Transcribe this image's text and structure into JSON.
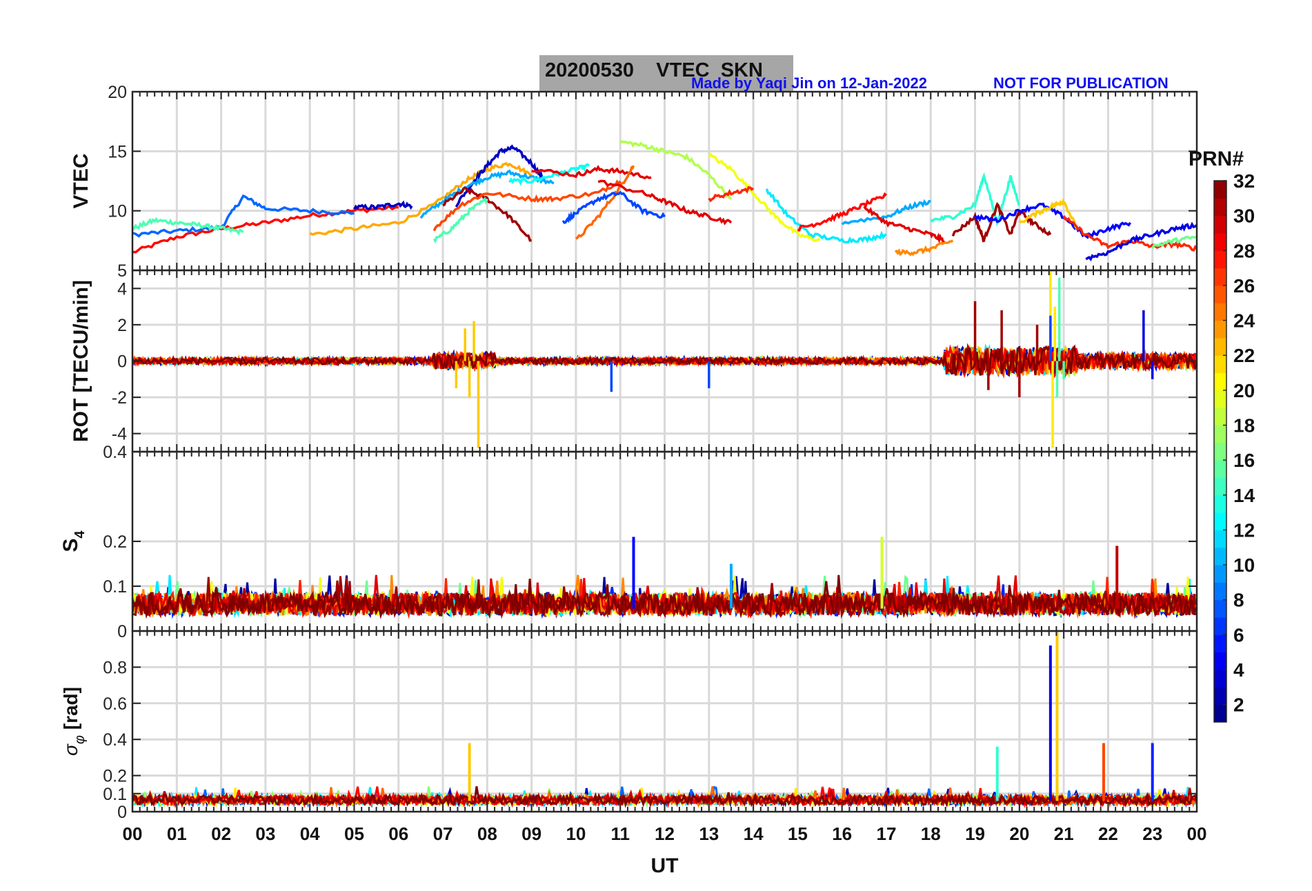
{
  "figure": {
    "title": "20200530    VTEC  SKN",
    "credit": "Made by Yaqi Jin on 12-Jan-2022",
    "notice": "NOT FOR PUBLICATION",
    "xlabel": "UT",
    "x_ticks": [
      "00",
      "01",
      "02",
      "03",
      "04",
      "05",
      "06",
      "07",
      "08",
      "09",
      "10",
      "11",
      "12",
      "13",
      "14",
      "15",
      "16",
      "17",
      "18",
      "19",
      "20",
      "21",
      "22",
      "23",
      "00"
    ]
  },
  "colorbar": {
    "label": "PRN#",
    "range": [
      1,
      32
    ],
    "ticks": [
      "2",
      "4",
      "6",
      "8",
      "10",
      "12",
      "14",
      "16",
      "18",
      "20",
      "22",
      "24",
      "26",
      "28",
      "30",
      "32"
    ],
    "colormap": "jet",
    "colors": [
      "#00008f",
      "#0000ff",
      "#007fff",
      "#00ffff",
      "#7fff7f",
      "#ffff00",
      "#ff7f00",
      "#ff0000",
      "#7f0000"
    ]
  },
  "chart_data": [
    {
      "type": "line",
      "ylabel": "VTEC",
      "ylim": [
        5,
        20
      ],
      "y_ticks": [
        "5",
        "10",
        "15",
        "20"
      ],
      "grid": true,
      "note": "Multiple PRN traces colored by PRN number via jet colormap",
      "series": [
        {
          "prn": 28,
          "x": [
            0.0,
            1.0,
            2.0,
            3.0,
            4.0,
            5.0,
            6.0
          ],
          "y": [
            6.5,
            7.8,
            8.5,
            9.0,
            9.6,
            10.0,
            10.3
          ]
        },
        {
          "prn": 8,
          "x": [
            0.0,
            1.0,
            2.0,
            2.5,
            3.0,
            4.0,
            5.0
          ],
          "y": [
            8.0,
            8.3,
            8.6,
            11.2,
            10.2,
            10.0,
            9.8
          ]
        },
        {
          "prn": 15,
          "x": [
            0.0,
            0.5,
            1.0,
            1.5,
            2.0,
            2.5
          ],
          "y": [
            8.5,
            9.2,
            9.0,
            8.8,
            8.5,
            8.2
          ]
        },
        {
          "prn": 3,
          "x": [
            5.0,
            5.5,
            6.0,
            6.3
          ],
          "y": [
            10.3,
            10.3,
            10.6,
            10.4
          ]
        },
        {
          "prn": 23,
          "x": [
            4.0,
            5.0,
            6.0,
            6.8,
            7.5,
            8.0,
            8.5,
            9.0
          ],
          "y": [
            8.0,
            8.5,
            9.0,
            10.5,
            12.5,
            13.5,
            14.0,
            13.0
          ]
        },
        {
          "prn": 3,
          "x": [
            7.3,
            7.7,
            8.0,
            8.3,
            8.6,
            9.0,
            9.3
          ],
          "y": [
            10.5,
            12.5,
            13.8,
            15.0,
            15.3,
            14.0,
            12.5
          ]
        },
        {
          "prn": 10,
          "x": [
            6.5,
            7.0,
            7.5,
            8.0,
            8.5,
            9.0,
            9.5
          ],
          "y": [
            9.5,
            10.8,
            12.0,
            12.8,
            13.2,
            12.8,
            12.3
          ]
        },
        {
          "prn": 13,
          "x": [
            8.5,
            9.0,
            9.5,
            10.0,
            10.3
          ],
          "y": [
            12.5,
            12.5,
            13.0,
            13.5,
            13.8
          ]
        },
        {
          "prn": 31,
          "x": [
            7.0,
            7.5,
            8.0,
            8.5,
            9.0
          ],
          "y": [
            10.5,
            11.8,
            11.0,
            9.5,
            7.5
          ]
        },
        {
          "prn": 15,
          "x": [
            6.8,
            7.2,
            7.6,
            8.0
          ],
          "y": [
            7.5,
            8.5,
            10.0,
            11.0
          ]
        },
        {
          "prn": 26,
          "x": [
            6.8,
            7.4,
            8.0,
            9.0,
            9.5,
            10.5,
            11.0
          ],
          "y": [
            8.5,
            10.5,
            11.5,
            11.0,
            11.0,
            11.5,
            12.5
          ]
        },
        {
          "prn": 29,
          "x": [
            9.0,
            10.0,
            10.5,
            11.0,
            11.7
          ],
          "y": [
            13.5,
            13.0,
            13.5,
            13.3,
            12.8
          ]
        },
        {
          "prn": 25,
          "x": [
            10.0,
            10.5,
            11.0,
            11.3
          ],
          "y": [
            7.5,
            9.5,
            12.0,
            13.8
          ]
        },
        {
          "prn": 7,
          "x": [
            9.7,
            10.0,
            10.5,
            11.0,
            11.5,
            12.0
          ],
          "y": [
            9.0,
            9.8,
            11.0,
            11.5,
            10.0,
            9.5
          ]
        },
        {
          "prn": 18,
          "x": [
            11.0,
            11.5,
            12.0,
            12.5,
            13.0,
            13.5
          ],
          "y": [
            15.8,
            15.5,
            15.0,
            14.5,
            13.0,
            11.0
          ]
        },
        {
          "prn": 20,
          "x": [
            13.0,
            13.5,
            14.0,
            14.5,
            15.0,
            15.5
          ],
          "y": [
            14.7,
            13.5,
            11.5,
            9.5,
            8.0,
            7.5
          ]
        },
        {
          "prn": 29,
          "x": [
            10.5,
            11.5,
            12.0,
            12.5,
            13.0,
            13.5
          ],
          "y": [
            12.5,
            11.5,
            10.8,
            10.0,
            9.5,
            9.0
          ]
        },
        {
          "prn": 27,
          "x": [
            13.0,
            13.5,
            14.0
          ],
          "y": [
            11.0,
            11.5,
            11.9
          ]
        },
        {
          "prn": 12,
          "x": [
            14.3,
            14.8,
            15.3,
            16.0,
            16.5,
            17.0
          ],
          "y": [
            11.8,
            9.5,
            8.0,
            7.5,
            7.6,
            8.0
          ]
        },
        {
          "prn": 28,
          "x": [
            15.0,
            15.5,
            16.0,
            16.5,
            17.0
          ],
          "y": [
            8.5,
            9.0,
            9.7,
            10.5,
            11.3
          ]
        },
        {
          "prn": 10,
          "x": [
            16.0,
            17.0,
            17.5,
            18.0
          ],
          "y": [
            9.0,
            9.5,
            10.3,
            10.8
          ]
        },
        {
          "prn": 29,
          "x": [
            16.5,
            17.0,
            17.5,
            18.0,
            18.3
          ],
          "y": [
            10.3,
            9.0,
            8.5,
            8.0,
            7.5
          ]
        },
        {
          "prn": 24,
          "x": [
            17.2,
            17.6,
            18.0,
            18.5
          ],
          "y": [
            6.5,
            6.5,
            6.8,
            7.5
          ]
        },
        {
          "prn": 14,
          "x": [
            18.0,
            18.5,
            19.0,
            19.2,
            19.5,
            19.8,
            20.0
          ],
          "y": [
            9.2,
            9.5,
            10.5,
            13.0,
            9.0,
            12.8,
            10.5
          ]
        },
        {
          "prn": 31,
          "x": [
            18.5,
            19.0,
            19.2,
            19.5,
            19.8,
            20.0,
            20.3,
            20.7
          ],
          "y": [
            8.0,
            9.5,
            7.5,
            10.5,
            8.0,
            10.0,
            9.0,
            8.0
          ]
        },
        {
          "prn": 5,
          "x": [
            19.0,
            19.5,
            20.0,
            20.5,
            21.0,
            21.5,
            22.0,
            22.5
          ],
          "y": [
            9.5,
            9.2,
            10.0,
            10.5,
            9.5,
            7.8,
            8.5,
            9.0
          ]
        },
        {
          "prn": 22,
          "x": [
            20.0,
            20.5,
            20.8,
            21.0,
            21.3
          ],
          "y": [
            9.0,
            10.0,
            10.5,
            10.8,
            8.5
          ]
        },
        {
          "prn": 27,
          "x": [
            21.0,
            21.5,
            22.0,
            22.5,
            23.0,
            23.5,
            24.0
          ],
          "y": [
            9.5,
            8.0,
            7.0,
            7.5,
            7.0,
            7.2,
            6.8
          ]
        },
        {
          "prn": 4,
          "x": [
            21.5,
            22.0,
            22.5,
            23.0,
            23.5,
            24.0
          ],
          "y": [
            6.0,
            6.5,
            7.5,
            8.0,
            8.5,
            8.8
          ]
        },
        {
          "prn": 16,
          "x": [
            23.0,
            23.5,
            24.0
          ],
          "y": [
            7.0,
            7.5,
            7.8
          ]
        }
      ]
    },
    {
      "type": "line",
      "ylabel": "ROT [TECU/min]",
      "ylim": [
        -5,
        5
      ],
      "y_ticks": [
        "-4",
        "-2",
        "0",
        "2",
        "4"
      ],
      "grid": true,
      "note": "ROT near 0 with bursts around 07:30 UT (up to ±4.8) and 18:30–21:00 UT (up to ±5)",
      "series": [
        {
          "prn": 22,
          "x": [
            7.3,
            7.5,
            7.6,
            7.7,
            7.8
          ],
          "y": [
            -1.5,
            1.8,
            -2.0,
            2.2,
            -4.8
          ]
        },
        {
          "prn": 31,
          "x": [
            19.0,
            19.3,
            19.6,
            20.0,
            20.4
          ],
          "y": [
            3.3,
            -1.6,
            2.8,
            -2.0,
            2.0
          ]
        },
        {
          "prn": 21,
          "x": [
            20.7,
            20.75,
            20.8
          ],
          "y": [
            5.0,
            -4.8,
            3.0
          ]
        },
        {
          "prn": 15,
          "x": [
            20.85,
            20.9,
            21.0
          ],
          "y": [
            -2.0,
            4.6,
            -1.0
          ]
        },
        {
          "prn": 7,
          "x": [
            10.8,
            13.0,
            20.7
          ],
          "y": [
            -1.7,
            -1.5,
            2.5
          ]
        },
        {
          "prn": 4,
          "x": [
            22.8,
            23.0
          ],
          "y": [
            2.8,
            -1.0
          ]
        }
      ]
    },
    {
      "type": "line",
      "ylabel": "S4",
      "ylim": [
        0,
        0.4
      ],
      "y_ticks": [
        "0",
        "0.1",
        "0.2"
      ],
      "y_top_label": "0.4",
      "grid": true,
      "note": "S4 baseline ~0.04–0.07 with spikes",
      "series": [
        {
          "prn": 5,
          "x": [
            11.3
          ],
          "y": [
            0.21
          ]
        },
        {
          "prn": 19,
          "x": [
            16.9
          ],
          "y": [
            0.21
          ]
        },
        {
          "prn": 30,
          "x": [
            22.2
          ],
          "y": [
            0.19
          ]
        },
        {
          "prn": 10,
          "x": [
            13.5
          ],
          "y": [
            0.15
          ]
        }
      ]
    },
    {
      "type": "line",
      "ylabel": "σφ [rad]",
      "ylim": [
        0,
        1
      ],
      "y_ticks": [
        "0",
        "0.1",
        "0.2",
        "0.4",
        "0.6",
        "0.8"
      ],
      "grid": true,
      "note": "Phase scintillation baseline ~0.05–0.1 with spikes",
      "series": [
        {
          "prn": 22,
          "x": [
            7.6
          ],
          "y": [
            0.38
          ]
        },
        {
          "prn": 4,
          "x": [
            20.7
          ],
          "y": [
            0.92
          ]
        },
        {
          "prn": 22,
          "x": [
            20.85
          ],
          "y": [
            1.0
          ]
        },
        {
          "prn": 14,
          "x": [
            19.5
          ],
          "y": [
            0.36
          ]
        },
        {
          "prn": 26,
          "x": [
            21.9
          ],
          "y": [
            0.38
          ]
        },
        {
          "prn": 6,
          "x": [
            23.0
          ],
          "y": [
            0.38
          ]
        }
      ]
    }
  ]
}
